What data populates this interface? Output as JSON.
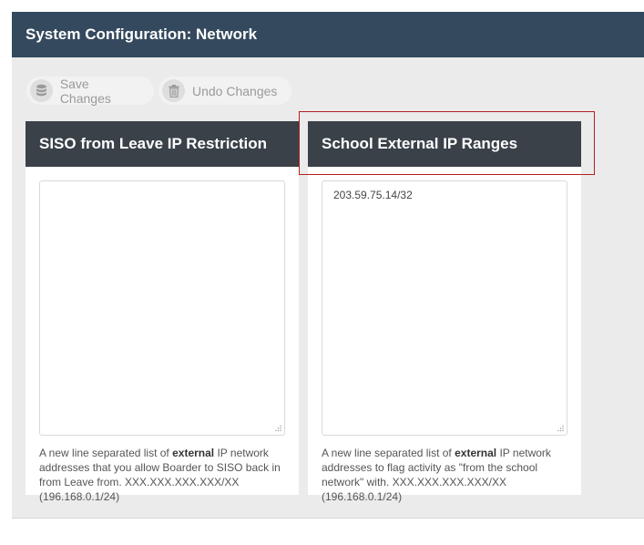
{
  "header": {
    "title": "System Configuration: Network"
  },
  "toolbar": {
    "save_label": "Save Changes",
    "save_icon": "database-icon",
    "undo_label": "Undo Changes",
    "undo_icon": "trash-icon"
  },
  "cards": [
    {
      "title": "SISO from Leave IP Restriction",
      "value": "",
      "help_pre": "A new line separated list of ",
      "help_bold": "external",
      "help_post": " IP network addresses that you allow Boarder to SISO back in from Leave from. XXX.XXX.XXX.XXX/XX (196.168.0.1/24)"
    },
    {
      "title": "School External IP Ranges",
      "value": "203.59.75.14/32",
      "help_pre": "A new line separated list of ",
      "help_bold": "external",
      "help_post": " IP network addresses to flag activity as \"from the school network\" with. XXX.XXX.XXX.XXX/XX (196.168.0.1/24)"
    }
  ],
  "colors": {
    "header_bg": "#34495e",
    "card_header_bg": "#3a4149",
    "highlight": "#b32020"
  }
}
